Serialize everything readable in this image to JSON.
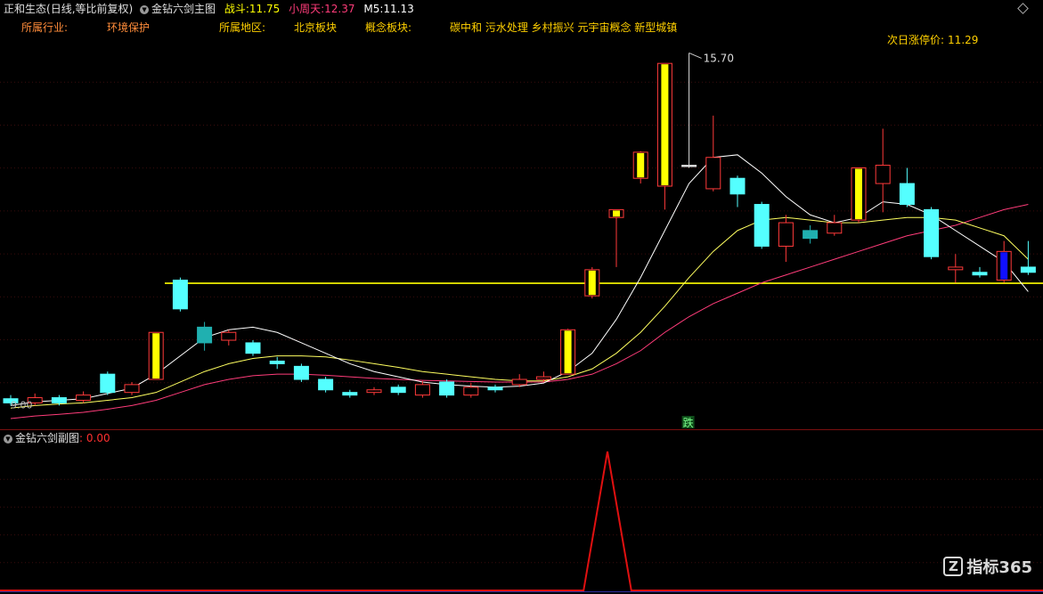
{
  "header": {
    "stock_name": "正和生态",
    "period_mode": "(日线,等比前复权)",
    "indicator_name": "金钻六剑主图",
    "zhandou_label": "战斗:",
    "zhandou_value": "11.75",
    "xiaozhoutian_label": "小周天:",
    "xiaozhoutian_value": "12.37",
    "m5_label": "M5:",
    "m5_value": "11.13"
  },
  "info": {
    "industry_label": "所属行业:",
    "industry_value": "环境保护",
    "region_label": "所属地区:",
    "region_value": "北京板块",
    "concept_label": "概念板块:",
    "concept_value": "碳中和 污水处理 乡村振兴 元宇宙概念 新型城镇",
    "limit_up_label": "次日涨停价:",
    "limit_up_value": "11.29"
  },
  "annotations": {
    "high_label": "15.70",
    "low_label": "9.00",
    "signal_label": "跌"
  },
  "sub_panel": {
    "title": "金钻六剑副图",
    "value": ": 0.00"
  },
  "logo": {
    "text": "指标365",
    "mark": "Z"
  },
  "colors": {
    "up": "#ff3a3a",
    "down": "#54ffff",
    "special_up": "#ffff00",
    "special_down": "#1010ff",
    "ma_short": "#ffffff",
    "ma_mid": "#ffff60",
    "ma_long": "#ff3c7a",
    "support_line": "#ffff00",
    "sub_line": "#e01010",
    "header_label": "#ff8c3a",
    "header_value": "#ffd000"
  },
  "chart_data": {
    "type": "candlestick",
    "price_range": [
      8.7,
      16.1
    ],
    "support_level": 11.29,
    "candles": [
      {
        "o": 9.0,
        "c": 9.08,
        "h": 9.15,
        "l": 8.95,
        "k": "down"
      },
      {
        "o": 9.0,
        "c": 9.1,
        "h": 9.18,
        "l": 8.95,
        "k": "up"
      },
      {
        "o": 9.1,
        "c": 9.0,
        "h": 9.15,
        "l": 8.95,
        "k": "down"
      },
      {
        "o": 9.05,
        "c": 9.15,
        "h": 9.22,
        "l": 9.0,
        "k": "up"
      },
      {
        "o": 9.55,
        "c": 9.2,
        "h": 9.6,
        "l": 9.15,
        "k": "down"
      },
      {
        "o": 9.2,
        "c": 9.35,
        "h": 9.4,
        "l": 9.15,
        "k": "up"
      },
      {
        "o": 9.45,
        "c": 10.35,
        "h": 10.35,
        "l": 9.45,
        "k": "yellow"
      },
      {
        "o": 11.35,
        "c": 10.8,
        "h": 11.4,
        "l": 10.75,
        "k": "down"
      },
      {
        "o": 10.45,
        "c": 10.15,
        "h": 10.55,
        "l": 10.0,
        "k": "teal"
      },
      {
        "o": 10.2,
        "c": 10.35,
        "h": 10.4,
        "l": 10.1,
        "k": "up"
      },
      {
        "o": 10.15,
        "c": 9.95,
        "h": 10.2,
        "l": 9.9,
        "k": "down"
      },
      {
        "o": 9.8,
        "c": 9.75,
        "h": 9.88,
        "l": 9.65,
        "k": "down"
      },
      {
        "o": 9.7,
        "c": 9.45,
        "h": 9.75,
        "l": 9.4,
        "k": "down"
      },
      {
        "o": 9.45,
        "c": 9.25,
        "h": 9.5,
        "l": 9.2,
        "k": "down"
      },
      {
        "o": 9.2,
        "c": 9.15,
        "h": 9.25,
        "l": 9.1,
        "k": "down"
      },
      {
        "o": 9.2,
        "c": 9.25,
        "h": 9.3,
        "l": 9.15,
        "k": "up"
      },
      {
        "o": 9.3,
        "c": 9.2,
        "h": 9.35,
        "l": 9.15,
        "k": "down"
      },
      {
        "o": 9.15,
        "c": 9.35,
        "h": 9.42,
        "l": 9.1,
        "k": "up"
      },
      {
        "o": 9.4,
        "c": 9.15,
        "h": 9.45,
        "l": 9.1,
        "k": "down"
      },
      {
        "o": 9.15,
        "c": 9.3,
        "h": 9.38,
        "l": 9.1,
        "k": "up"
      },
      {
        "o": 9.3,
        "c": 9.25,
        "h": 9.35,
        "l": 9.2,
        "k": "down"
      },
      {
        "o": 9.35,
        "c": 9.45,
        "h": 9.55,
        "l": 9.3,
        "k": "up"
      },
      {
        "o": 9.45,
        "c": 9.5,
        "h": 9.6,
        "l": 9.4,
        "k": "up"
      },
      {
        "o": 9.55,
        "c": 10.4,
        "h": 10.42,
        "l": 9.55,
        "k": "yellow"
      },
      {
        "o": 11.05,
        "c": 11.55,
        "h": 11.6,
        "l": 11.0,
        "k": "yellow"
      },
      {
        "o": 12.55,
        "c": 12.7,
        "h": 12.7,
        "l": 11.6,
        "k": "yellow"
      },
      {
        "o": 13.3,
        "c": 13.8,
        "h": 13.82,
        "l": 13.2,
        "k": "yellow"
      },
      {
        "o": 13.15,
        "c": 15.5,
        "h": 15.5,
        "l": 12.7,
        "k": "yellow"
      },
      {
        "o": 13.55,
        "c": 13.55,
        "h": 15.7,
        "l": 13.5,
        "k": "flat"
      },
      {
        "o": 13.1,
        "c": 13.7,
        "h": 14.5,
        "l": 13.05,
        "k": "up"
      },
      {
        "o": 13.3,
        "c": 13.0,
        "h": 13.35,
        "l": 12.75,
        "k": "down"
      },
      {
        "o": 12.8,
        "c": 12.0,
        "h": 12.85,
        "l": 11.95,
        "k": "down"
      },
      {
        "o": 12.0,
        "c": 12.45,
        "h": 12.6,
        "l": 11.7,
        "k": "up"
      },
      {
        "o": 12.3,
        "c": 12.15,
        "h": 12.4,
        "l": 12.05,
        "k": "teal"
      },
      {
        "o": 12.25,
        "c": 12.45,
        "h": 12.6,
        "l": 12.2,
        "k": "up"
      },
      {
        "o": 12.5,
        "c": 13.5,
        "h": 13.5,
        "l": 12.45,
        "k": "yellow"
      },
      {
        "o": 13.2,
        "c": 13.55,
        "h": 14.25,
        "l": 12.65,
        "k": "up"
      },
      {
        "o": 13.2,
        "c": 12.8,
        "h": 13.5,
        "l": 12.75,
        "k": "down"
      },
      {
        "o": 12.7,
        "c": 11.8,
        "h": 12.75,
        "l": 11.75,
        "k": "down"
      },
      {
        "o": 11.55,
        "c": 11.6,
        "h": 11.85,
        "l": 11.3,
        "k": "up"
      },
      {
        "o": 11.5,
        "c": 11.45,
        "h": 11.6,
        "l": 11.4,
        "k": "down"
      },
      {
        "o": 11.35,
        "c": 11.9,
        "h": 12.1,
        "l": 11.3,
        "k": "blue"
      },
      {
        "o": 11.6,
        "c": 11.5,
        "h": 12.1,
        "l": 11.45,
        "k": "down"
      }
    ],
    "ma_short": [
      8.95,
      9.02,
      9.05,
      9.08,
      9.18,
      9.28,
      9.55,
      9.9,
      10.25,
      10.4,
      10.45,
      10.35,
      10.15,
      9.95,
      9.75,
      9.6,
      9.5,
      9.4,
      9.35,
      9.32,
      9.3,
      9.32,
      9.38,
      9.6,
      9.95,
      10.6,
      11.4,
      12.3,
      13.2,
      13.7,
      13.75,
      13.4,
      12.95,
      12.6,
      12.45,
      12.55,
      12.85,
      12.8,
      12.6,
      12.3,
      12.0,
      11.7,
      11.13
    ],
    "ma_mid": [
      8.9,
      8.95,
      8.98,
      9.0,
      9.05,
      9.1,
      9.2,
      9.4,
      9.6,
      9.75,
      9.85,
      9.9,
      9.9,
      9.88,
      9.82,
      9.75,
      9.68,
      9.6,
      9.55,
      9.5,
      9.45,
      9.42,
      9.42,
      9.5,
      9.65,
      9.95,
      10.35,
      10.85,
      11.4,
      11.9,
      12.3,
      12.5,
      12.55,
      12.5,
      12.45,
      12.45,
      12.5,
      12.55,
      12.55,
      12.5,
      12.35,
      12.2,
      11.75
    ],
    "ma_long": [
      8.7,
      8.75,
      8.78,
      8.82,
      8.88,
      8.95,
      9.05,
      9.2,
      9.35,
      9.45,
      9.52,
      9.55,
      9.55,
      9.53,
      9.5,
      9.47,
      9.45,
      9.43,
      9.42,
      9.41,
      9.4,
      9.4,
      9.4,
      9.45,
      9.55,
      9.75,
      10.0,
      10.35,
      10.65,
      10.9,
      11.1,
      11.3,
      11.45,
      11.6,
      11.75,
      11.9,
      12.05,
      12.2,
      12.3,
      12.4,
      12.55,
      12.7,
      12.8
    ],
    "sub_values": [
      0,
      0,
      0,
      0,
      0,
      0,
      0,
      0,
      0,
      0,
      0,
      0,
      0,
      0,
      0,
      0,
      0,
      0,
      0,
      0,
      0,
      0,
      0,
      0,
      0,
      1,
      0,
      0,
      0,
      0,
      0,
      0,
      0,
      0,
      0,
      0,
      0,
      0,
      0,
      0,
      0,
      0,
      0
    ],
    "sub_range": [
      0,
      1
    ]
  }
}
